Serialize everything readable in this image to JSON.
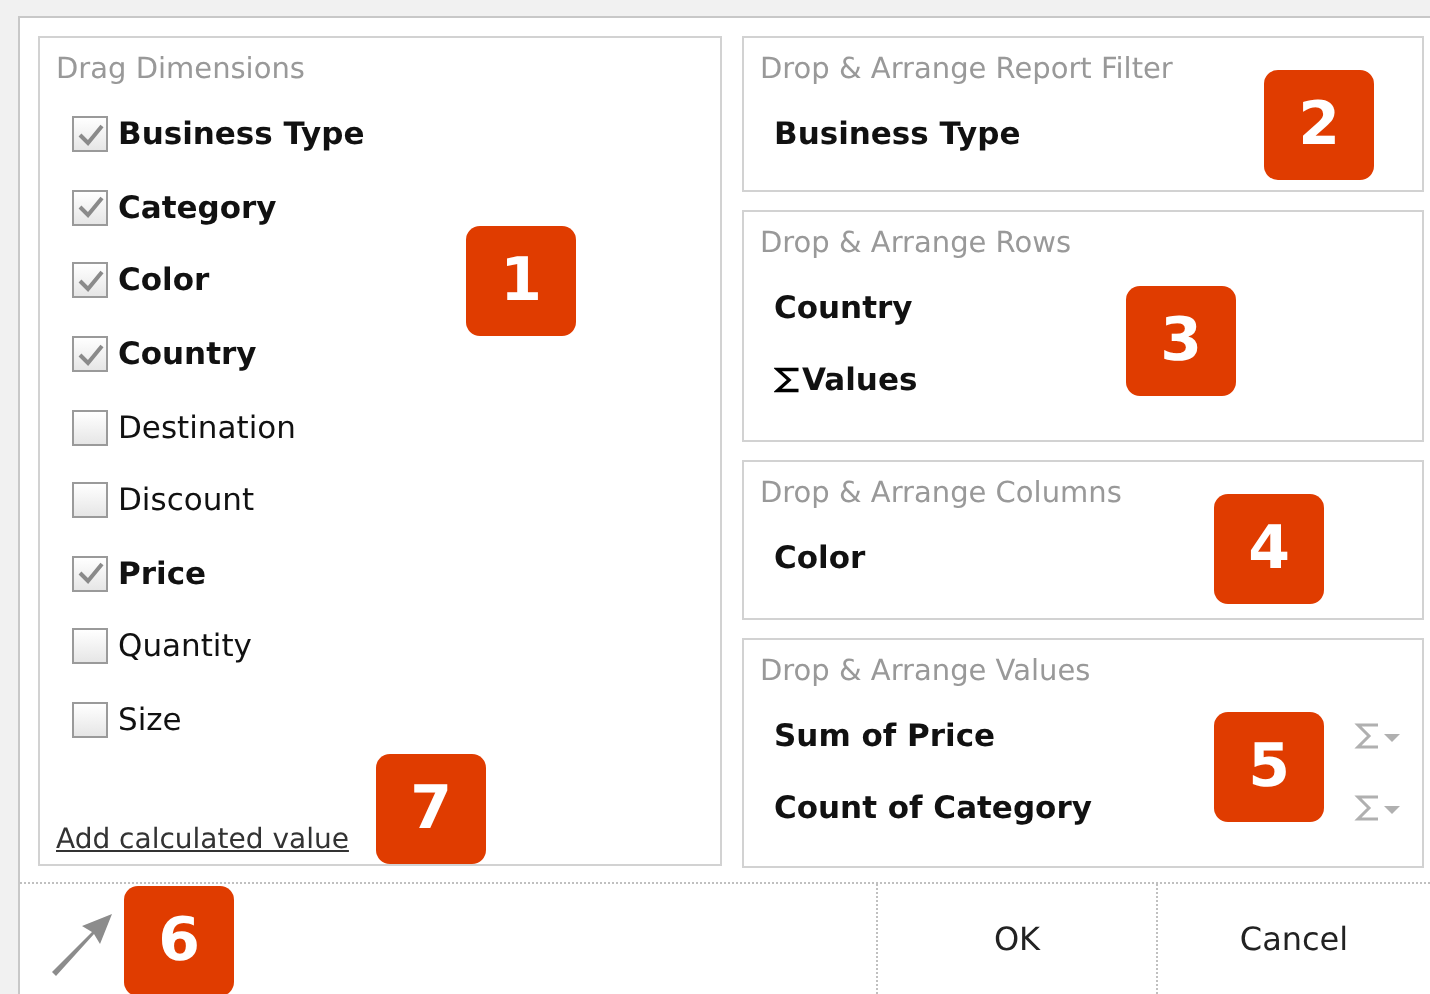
{
  "dimensions": {
    "title": "Drag Dimensions",
    "items": [
      {
        "label": "Business Type",
        "checked": true
      },
      {
        "label": "Category",
        "checked": true
      },
      {
        "label": "Color",
        "checked": true
      },
      {
        "label": "Country",
        "checked": true
      },
      {
        "label": "Destination",
        "checked": false
      },
      {
        "label": "Discount",
        "checked": false
      },
      {
        "label": "Price",
        "checked": true
      },
      {
        "label": "Quantity",
        "checked": false
      },
      {
        "label": "Size",
        "checked": false
      }
    ],
    "link": "Add calculated value"
  },
  "areas": [
    {
      "title": "Drop & Arrange Report Filter",
      "items": [
        {
          "label": "Business Type",
          "kind": "field"
        }
      ]
    },
    {
      "title": "Drop & Arrange Rows",
      "items": [
        {
          "label": "Country",
          "kind": "field"
        },
        {
          "label": "Values",
          "kind": "values"
        }
      ]
    },
    {
      "title": "Drop & Arrange Columns",
      "items": [
        {
          "label": "Color",
          "kind": "field"
        }
      ]
    },
    {
      "title": "Drop & Arrange Values",
      "items": [
        {
          "label": "Sum of Price",
          "kind": "aggregate"
        },
        {
          "label": "Count of Category",
          "kind": "aggregate"
        }
      ]
    }
  ],
  "buttons": [
    "OK",
    "Cancel"
  ],
  "badges": [
    "1",
    "2",
    "3",
    "4",
    "5",
    "6",
    "7"
  ]
}
